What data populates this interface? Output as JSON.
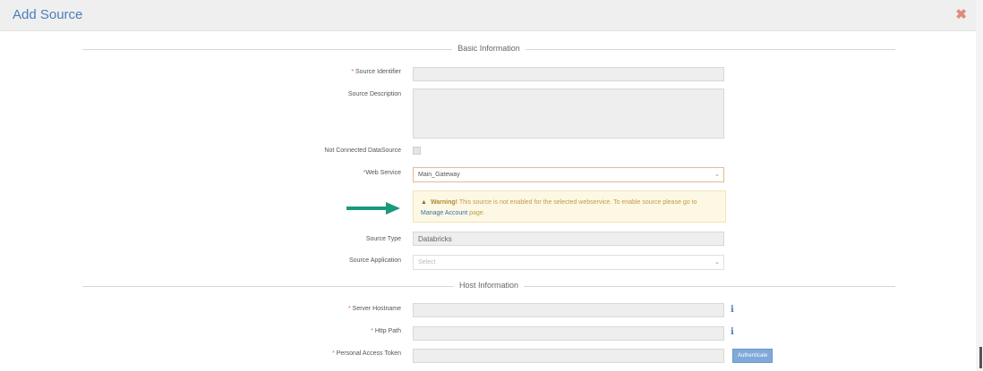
{
  "header": {
    "title": "Add Source",
    "close_icon": "close-icon"
  },
  "sections": {
    "basic": "Basic Information",
    "host": "Host Information"
  },
  "fields": {
    "source_identifier": {
      "label": "Source Identifier",
      "value": ""
    },
    "source_description": {
      "label": "Source Description",
      "value": ""
    },
    "not_connected": {
      "label": "Not Connected DataSource"
    },
    "web_service": {
      "label": "Web Service",
      "value": "Main_Gateway"
    },
    "source_type": {
      "label": "Source Type",
      "value": "Databricks"
    },
    "source_application": {
      "label": "Source Application",
      "placeholder": "Select"
    },
    "server_hostname": {
      "label": "Server Hostname",
      "value": ""
    },
    "http_path": {
      "label": "Http Path",
      "value": ""
    },
    "personal_access_token": {
      "label": "Personal Access Token",
      "value": ""
    }
  },
  "warning": {
    "title": "Warning!",
    "text_before": "This source is not enabled for the selected webservice. To enable source please go to",
    "link": "Manage Account",
    "text_after": "page."
  },
  "buttons": {
    "authenticate": "Authenticate"
  },
  "colors": {
    "accent": "#4a7ebb",
    "arrow": "#1a9a7c",
    "required": "#e06060"
  }
}
